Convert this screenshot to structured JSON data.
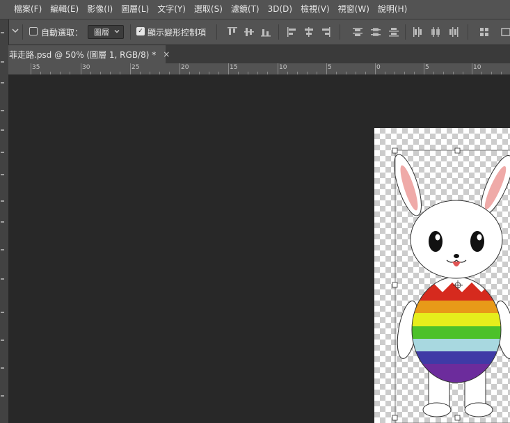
{
  "menubar": {
    "items": [
      "檔案(F)",
      "編輯(E)",
      "影像(I)",
      "圖層(L)",
      "文字(Y)",
      "選取(S)",
      "濾鏡(T)",
      "3D(D)",
      "檢視(V)",
      "視窗(W)",
      "說明(H)"
    ]
  },
  "options": {
    "auto_select_label": "自動選取：",
    "auto_select_checked": false,
    "auto_select_target": "圖層",
    "show_transform_label": "顯示變形控制項",
    "show_transform_checked": true
  },
  "tab": {
    "title": "菲走路.psd @ 50% (圖層 1, RGB/8) *",
    "close": "×"
  },
  "ruler": {
    "labels": [
      "35",
      "30",
      "25",
      "20",
      "15",
      "10",
      "5",
      "0",
      "5",
      "10"
    ]
  },
  "icons": {
    "tab_close": "close-icon",
    "dropdown": "chevron-down-icon",
    "tool_options": "chevron-down-icon"
  },
  "colors": {
    "ui_bg": "#535353",
    "workspace": "#282828",
    "stripes": [
      "#d62a1e",
      "#e89a18",
      "#e6ee1c",
      "#4cc12a",
      "#a8d8e0",
      "#3f3aa6",
      "#6c2c9c"
    ],
    "ear_inner": "#efaaa8"
  }
}
